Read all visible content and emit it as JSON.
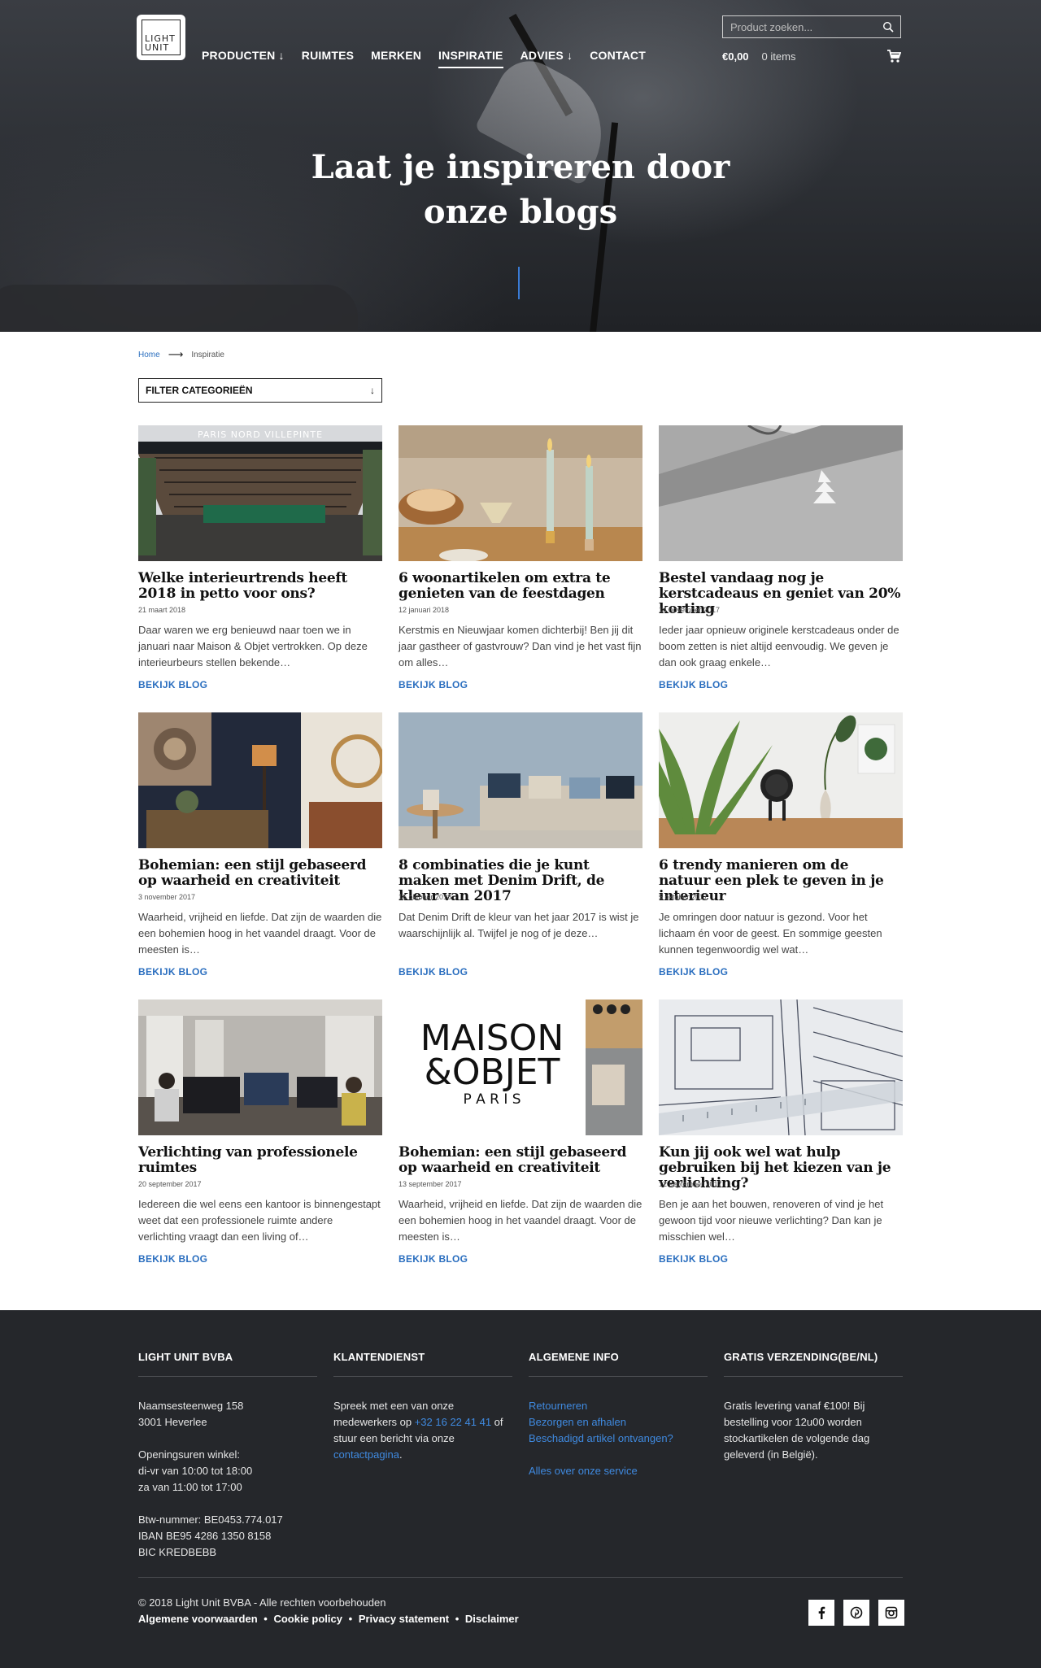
{
  "brand": {
    "logo_text": "LIGHT UNIT",
    "accent": "#2a6ebf"
  },
  "nav": {
    "items": [
      {
        "label": "PRODUCTEN ↓"
      },
      {
        "label": "RUIMTES"
      },
      {
        "label": "MERKEN"
      },
      {
        "label": "INSPIRATIE"
      },
      {
        "label": "ADVIES ↓"
      },
      {
        "label": "CONTACT"
      }
    ]
  },
  "search": {
    "placeholder": "Product zoeken..."
  },
  "cart": {
    "total": "€0,00",
    "items": "0 items"
  },
  "hero": {
    "title_line1": "Laat je inspireren door",
    "title_line2": "onze blogs"
  },
  "breadcrumb": {
    "home": "Home",
    "current": "Inspiratie"
  },
  "filter": {
    "label": "FILTER CATEGORIEËN",
    "arrow": "↓"
  },
  "blogs": [
    {
      "title": "Welke interieurtrends heeft 2018 in petto voor ons?",
      "date": "21 maart 2018",
      "excerpt": "Daar waren we erg benieuwd naar toen we in januari naar Maison & Objet vertrokken. Op deze interieurbeurs stellen bekende…",
      "link": "BEKIJK BLOG"
    },
    {
      "title": "6 woonartikelen om extra te genieten van de feestdagen",
      "date": "12 januari 2018",
      "excerpt": "Kerstmis en Nieuwjaar komen dichterbij! Ben jij dit jaar gastheer of gastvrouw? Dan vind je het vast fijn om alles…",
      "link": "BEKIJK BLOG"
    },
    {
      "title": "Bestel vandaag nog je kerstcadeaus en geniet van 20% korting",
      "date": "14 november 2017",
      "excerpt": "Ieder jaar opnieuw originele kerstcadeaus onder de boom zetten is niet altijd eenvoudig. We geven je dan ook graag enkele…",
      "link": "BEKIJK BLOG"
    },
    {
      "title": "Bohemian: een stijl gebaseerd op waarheid en creativiteit",
      "date": "3 november 2017",
      "excerpt": "Waarheid, vrijheid en liefde. Dat zijn de waarden die een bohemien hoog in het vaandel draagt. Voor de meesten is…",
      "link": "BEKIJK BLOG"
    },
    {
      "title": "8 combinaties die je kunt maken met Denim Drift, de kleur van 2017",
      "date": "16 oktober 2018",
      "excerpt": "Dat Denim Drift de kleur van het jaar 2017 is wist je waarschijnlijk al. Twijfel je nog of je deze…",
      "link": "BEKIJK BLOG"
    },
    {
      "title": "6 trendy manieren om de natuur een plek te geven in je interieur",
      "date": "5 oktober 2017",
      "excerpt": "Je omringen door natuur is gezond. Voor het lichaam én voor de geest. En sommige geesten kunnen tegenwoordig wel wat…",
      "link": "BEKIJK BLOG"
    },
    {
      "title": "Verlichting van professionele ruimtes",
      "date": "20 september 2017",
      "excerpt": "Iedereen die wel eens een kantoor is binnengestapt weet dat een professionele ruimte andere verlichting vraagt dan een living of…",
      "link": "BEKIJK BLOG"
    },
    {
      "title": "Bohemian: een stijl gebaseerd op waarheid en creativiteit",
      "date": "13 september 2017",
      "excerpt": "Waarheid, vrijheid en liefde. Dat zijn de waarden die een bohemien hoog in het vaandel draagt. Voor de meesten is…",
      "link": "BEKIJK BLOG"
    },
    {
      "title": "Kun jij ook wel wat hulp gebruiken bij het kiezen van je verlichting?",
      "date": "12 september 2017",
      "excerpt": "Ben je aan het bouwen, renoveren of vind je het gewoon tijd voor nieuwe verlichting? Dan kan je misschien wel…",
      "link": "BEKIJK BLOG"
    }
  ],
  "image_text": {
    "paris_sign": "PARIS NORD VILLEPINTE",
    "maison_line1": "MAISON",
    "maison_line2": "&OBJET",
    "maison_line3": "P A R I S"
  },
  "footer": {
    "col1": {
      "heading": "LIGHT UNIT BVBA",
      "address1": "Naamsesteenweg 158",
      "address2": "3001 Heverlee",
      "hours_title": "Openingsuren winkel:",
      "hours1": "di-vr van 10:00 tot 18:00",
      "hours2": "za van 11:00 tot 17:00",
      "vat": "Btw-nummer: BE0453.774.017",
      "iban": "IBAN BE95 4286 1350 8158",
      "bic": "BIC KREDBEBB"
    },
    "col2": {
      "heading": "KLANTENDIENST",
      "text1": "Spreek met een van onze medewerkers op ",
      "phone": "+32 16 22 41 41",
      "text2": " of stuur een bericht via onze ",
      "contact_link": "contactpagina",
      "text3": "."
    },
    "col3": {
      "heading": "ALGEMENE INFO",
      "links": [
        "Retourneren",
        "Bezorgen en afhalen",
        "Beschadigd artikel ontvangen?"
      ],
      "service_link": "Alles over onze service"
    },
    "col4": {
      "heading": "GRATIS VERZENDING(BE/NL)",
      "text": "Gratis levering vanaf €100! Bij bestelling voor 12u00 worden stockartikelen de volgende dag geleverd (in België)."
    },
    "copyright": "© 2018 Light Unit BVBA - Alle rechten voorbehouden",
    "legal": [
      "Algemene voorwaarden",
      "Cookie policy",
      "Privacy statement",
      "Disclaimer"
    ],
    "legal_sep": "•",
    "social": [
      "facebook-icon",
      "pinterest-icon",
      "instagram-icon"
    ]
  }
}
